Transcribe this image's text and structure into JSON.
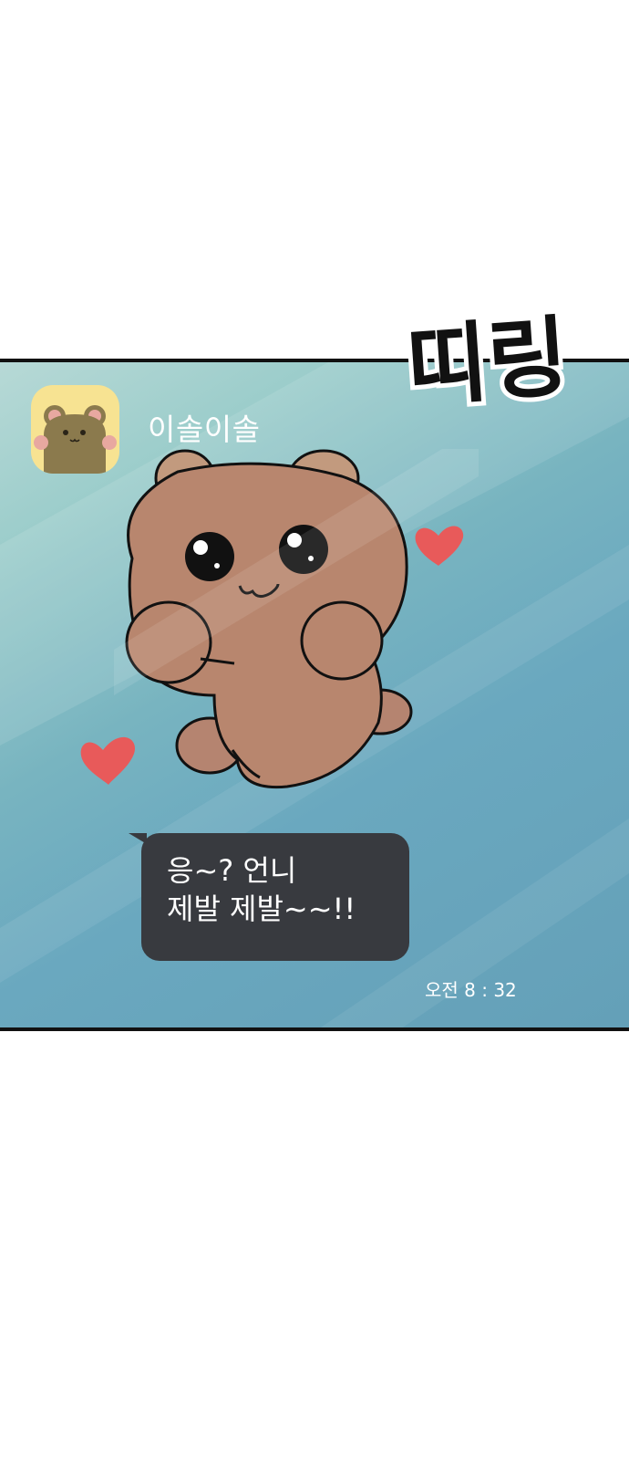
{
  "chat": {
    "sender_name": "이솔이솔",
    "message_lines": [
      "응~? 언니",
      "제발 제발~~!!"
    ],
    "timestamp": "오전 8 : 32"
  },
  "sound_effect": {
    "text": "띠링"
  },
  "icons": {
    "avatar": "bear-avatar-icon",
    "sticker": "bear-sticker",
    "hearts": "heart-icon"
  },
  "colors": {
    "panel_bg": "#6aa8bf",
    "bubble_bg": "#383a3f",
    "avatar_bg": "#f7e392",
    "heart": "#e85a5a",
    "bear": "#b8866e"
  }
}
